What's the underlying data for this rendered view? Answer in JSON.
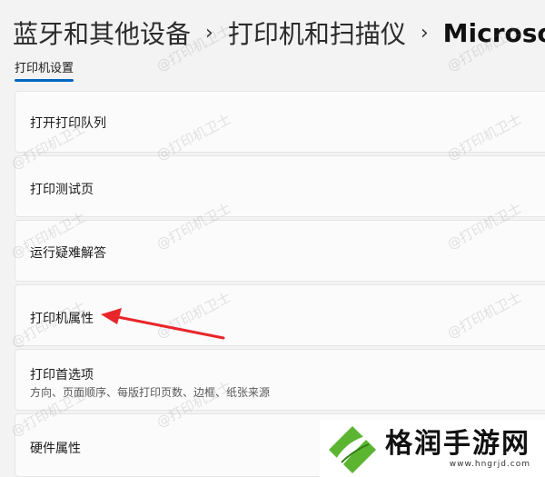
{
  "breadcrumb": {
    "items": [
      "蓝牙和其他设备",
      "打印机和扫描仪",
      "Microso"
    ],
    "separator": "›"
  },
  "tab": {
    "label": "打印机设置"
  },
  "settings": [
    {
      "label": "打开打印队列"
    },
    {
      "label": "打印测试页"
    },
    {
      "label": "运行疑难解答"
    },
    {
      "label": "打印机属性"
    },
    {
      "label": "打印首选项",
      "description": "方向、页面顺序、每版打印页数、边框、纸张来源"
    },
    {
      "label": "硬件属性"
    }
  ],
  "watermark": "@打印机卫士",
  "logo": {
    "name": "格润手游网",
    "url": "www.hngrjd.com"
  },
  "colors": {
    "accent": "#0067c0",
    "annotation_arrow": "#e8262a",
    "logo_green": "#5cb531"
  }
}
